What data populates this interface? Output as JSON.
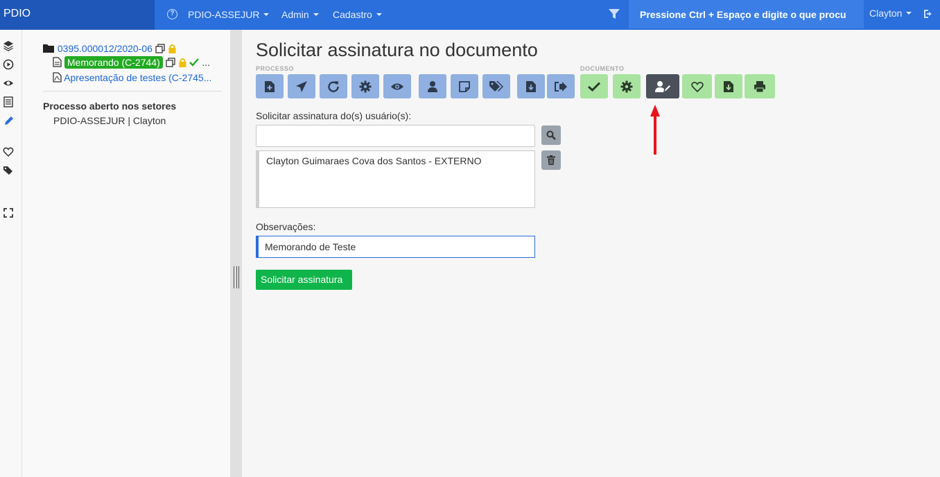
{
  "navbar": {
    "brand": "PDIO",
    "help_icon": "?",
    "menu": [
      "PDIO-ASSEJUR",
      "Admin",
      "Cadastro"
    ],
    "search_text": "Pressione Ctrl + Espaço e digite o que procu",
    "user": "Clayton"
  },
  "rail": {
    "icons": [
      "layers-icon",
      "play-icon",
      "eye-icon",
      "document-icon",
      "pen-icon",
      "heart-icon",
      "tags-icon",
      "fullscreen-icon"
    ]
  },
  "tree": {
    "process": "0395.000012/2020-06",
    "doc1": "Memorando (C-2744)",
    "doc1_more": "...",
    "doc2": "Apresentação de testes (C-2745...",
    "section_title": "Processo aberto nos setores",
    "section_item": "PDIO-ASSEJUR | Clayton"
  },
  "main": {
    "title": "Solicitar assinatura no documento",
    "group_process": "PROCESSO",
    "group_document": "DOCUMENTO",
    "users_label": "Solicitar assinatura do(s) usuário(s):",
    "users_input_value": "",
    "selected_user": "Clayton Guimaraes Cova dos Santos - EXTERNO",
    "obs_label": "Observações:",
    "obs_value": "Memorando de Teste",
    "submit_label": "Solicitar assinatura"
  },
  "toolbar": {
    "process_buttons": [
      "new-document-icon",
      "send-icon",
      "refresh-icon",
      "gear-icon",
      "eye-icon",
      "user-icon",
      "note-icon",
      "tags-icon",
      "download-icon",
      "exit-icon"
    ],
    "document_buttons": [
      "check-icon",
      "gear-icon",
      "user-sign-icon",
      "heart-icon",
      "download-icon",
      "print-icon"
    ]
  },
  "colors": {
    "navbar": "#2a6fdb",
    "brand": "#1f57b8",
    "process_button": "#8fb0e0",
    "document_button": "#a9e3a0",
    "active_button": "#4b505a",
    "submit": "#0fb54a",
    "annotation_arrow": "#e8141b"
  }
}
